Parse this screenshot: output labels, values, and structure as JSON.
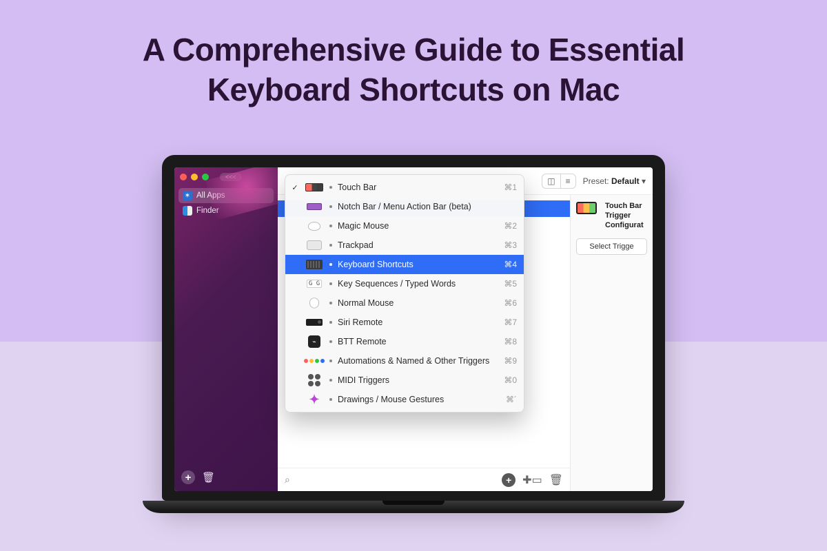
{
  "hero": {
    "title_line1": "A Comprehensive Guide to Essential",
    "title_line2": "Keyboard Shortcuts on Mac"
  },
  "sidebar": {
    "back_label": "<<<",
    "items": [
      {
        "label": "All Apps",
        "selected": true,
        "icon_bg": "#2a6fd4"
      },
      {
        "label": "Finder",
        "selected": false,
        "icon_bg": "#2a8fe0"
      }
    ],
    "add_label": "+",
    "trash_label": "🗑"
  },
  "toolbar": {
    "view_left_glyph": "◫",
    "view_right_glyph": "≡",
    "preset_prefix": "Preset:",
    "preset_name": "Default",
    "preset_caret": "▾"
  },
  "dropdown": {
    "items": [
      {
        "label": "Touch Bar",
        "shortcut": "⌘1",
        "checked": true,
        "icon": "touchbar"
      },
      {
        "label": "Notch Bar / Menu Action Bar (beta)",
        "shortcut": "",
        "checked": false,
        "icon": "notch"
      },
      {
        "label": "Magic Mouse",
        "shortcut": "⌘2",
        "checked": false,
        "icon": "mouse"
      },
      {
        "label": "Trackpad",
        "shortcut": "⌘3",
        "checked": false,
        "icon": "trackpad"
      },
      {
        "label": "Keyboard Shortcuts",
        "shortcut": "⌘4",
        "checked": false,
        "icon": "keyboard",
        "selected": true
      },
      {
        "label": "Key Sequences / Typed Words",
        "shortcut": "⌘5",
        "checked": false,
        "icon": "keyseq"
      },
      {
        "label": "Normal Mouse",
        "shortcut": "⌘6",
        "checked": false,
        "icon": "normalmouse"
      },
      {
        "label": "Siri Remote",
        "shortcut": "⌘7",
        "checked": false,
        "icon": "siri"
      },
      {
        "label": "BTT Remote",
        "shortcut": "⌘8",
        "checked": false,
        "icon": "btt"
      },
      {
        "label": "Automations & Named & Other Triggers",
        "shortcut": "⌘9",
        "checked": false,
        "icon": "auto"
      },
      {
        "label": "MIDI Triggers",
        "shortcut": "⌘0",
        "checked": false,
        "icon": "midi"
      },
      {
        "label": "Drawings / Mouse Gestures",
        "shortcut": "⌘´",
        "checked": false,
        "icon": "draw"
      }
    ]
  },
  "right_panel": {
    "title_line1": "Touch Bar",
    "title_line2": "Trigger",
    "title_line3": "Configurat",
    "select_trigger_label": "Select Trigge"
  },
  "main_bottom": {
    "search_glyph": "⌕",
    "add_glyph": "+",
    "folder_glyph": "⌂",
    "trash_glyph": "🗑"
  }
}
